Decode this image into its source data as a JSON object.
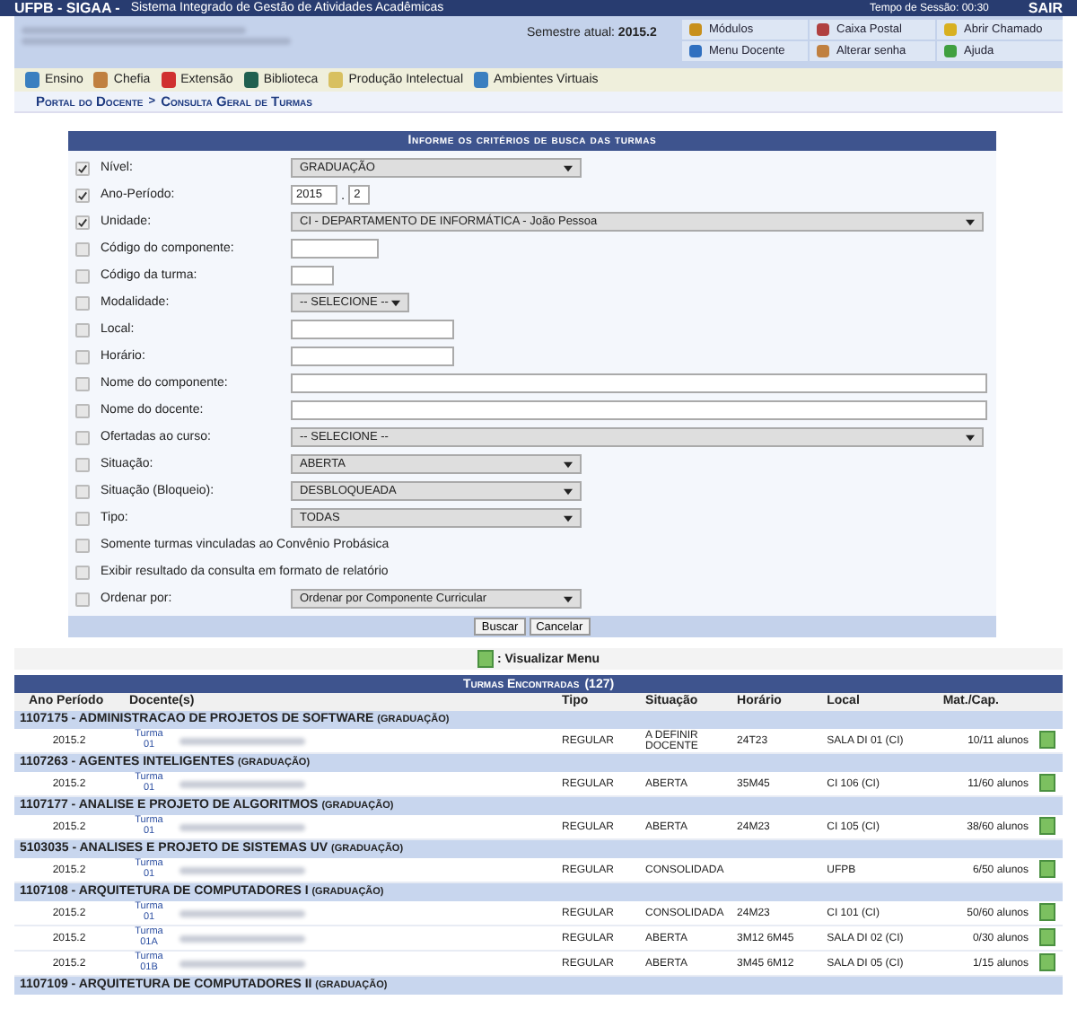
{
  "top_bar": {
    "title": "UFPB - SIGAA -",
    "subtitle": "Sistema Integrado de Gestão de Atividades Acadêmicas",
    "session": "Tempo de Sessão: 00:30",
    "logout": "SAIR"
  },
  "header": {
    "semester_label": "Semestre atual:",
    "semester": "2015.2",
    "shortcuts": [
      {
        "label": "Módulos"
      },
      {
        "label": "Caixa Postal"
      },
      {
        "label": "Abrir Chamado"
      },
      {
        "label": "Menu Docente"
      },
      {
        "label": "Alterar senha"
      },
      {
        "label": "Ajuda"
      }
    ]
  },
  "menu": [
    {
      "label": "Ensino"
    },
    {
      "label": "Chefia"
    },
    {
      "label": "Extensão"
    },
    {
      "label": "Biblioteca"
    },
    {
      "label": "Produção Intelectual"
    },
    {
      "label": "Ambientes Virtuais"
    }
  ],
  "breadcrumb": {
    "portal": "Portal do Docente",
    "separator": ">",
    "page": "Consulta Geral de Turmas"
  },
  "form": {
    "title": "Informe os critérios de busca das turmas",
    "fields": [
      {
        "label": "Nível:",
        "checked": true,
        "kind": "select",
        "value": "GRADUAÇÃO"
      },
      {
        "label": "Ano-Período:",
        "checked": true,
        "kind": "period",
        "value": "2015",
        "value_2": "2",
        "separator": "."
      },
      {
        "label": "Unidade:",
        "checked": true,
        "kind": "select_wide",
        "value": "CI - DEPARTAMENTO DE INFORMÁTICA - João Pessoa"
      },
      {
        "label": "Código do componente:",
        "checked": false,
        "kind": "text_short"
      },
      {
        "label": "Código da turma:",
        "checked": false,
        "kind": "text_tiny"
      },
      {
        "label": "Modalidade:",
        "checked": false,
        "kind": "select_short",
        "value": "-- SELECIONE --"
      },
      {
        "label": "Local:",
        "checked": false,
        "kind": "text_medium"
      },
      {
        "label": "Horário:",
        "checked": false,
        "kind": "text_medium"
      },
      {
        "label": "Nome do componente:",
        "checked": false,
        "kind": "text_long"
      },
      {
        "label": "Nome do docente:",
        "checked": false,
        "kind": "text_long"
      },
      {
        "label": "Ofertadas ao curso:",
        "checked": false,
        "kind": "select_wide",
        "value": "-- SELECIONE --"
      },
      {
        "label": "Situação:",
        "checked": false,
        "kind": "select",
        "value": "ABERTA"
      },
      {
        "label": "Situação (Bloqueio):",
        "checked": false,
        "kind": "select",
        "value": "DESBLOQUEADA"
      },
      {
        "label": "Tipo:",
        "checked": false,
        "kind": "select",
        "value": "TODAS"
      },
      {
        "label": "Somente turmas vinculadas ao Convênio Probásica",
        "checked": false,
        "kind": "none"
      },
      {
        "label": "Exibir resultado da consulta em formato de relatório",
        "checked": false,
        "kind": "none"
      },
      {
        "label": "Ordenar por:",
        "checked": false,
        "kind": "select",
        "value": "Ordenar por Componente Curricular"
      }
    ],
    "buttons": [
      "Buscar",
      "Cancelar"
    ]
  },
  "legend": {
    "text": ": Visualizar Menu"
  },
  "results": {
    "title": "Turmas Encontradas",
    "count": "(127)",
    "columns": [
      "Ano Período",
      "Docente(s)",
      "Tipo",
      "Situação",
      "Horário",
      "Local",
      "Mat./Cap."
    ],
    "groups": [
      {
        "title": "1107175 - ADMINISTRACAO DE PROJETOS DE SOFTWARE",
        "level": "(GRADUAÇÃO)",
        "classes": [
          {
            "period": "2015.2",
            "class": "Turma 01",
            "type": "REGULAR",
            "status": "A DEFINIR DOCENTE",
            "schedule": "24T23",
            "place": "SALA DI 01 (CI)",
            "enrolled": "10/11 alunos"
          }
        ]
      },
      {
        "title": "1107263 - AGENTES INTELIGENTES",
        "level": "(GRADUAÇÃO)",
        "classes": [
          {
            "period": "2015.2",
            "class": "Turma 01",
            "type": "REGULAR",
            "status": "ABERTA",
            "schedule": "35M45",
            "place": "CI 106 (CI)",
            "enrolled": "11/60 alunos"
          }
        ]
      },
      {
        "title": "1107177 - ANALISE E PROJETO DE ALGORITMOS",
        "level": "(GRADUAÇÃO)",
        "classes": [
          {
            "period": "2015.2",
            "class": "Turma 01",
            "type": "REGULAR",
            "status": "ABERTA",
            "schedule": "24M23",
            "place": "CI 105 (CI)",
            "enrolled": "38/60 alunos"
          }
        ]
      },
      {
        "title": "5103035 - ANALISES E PROJETO DE SISTEMAS UV",
        "level": "(GRADUAÇÃO)",
        "classes": [
          {
            "period": "2015.2",
            "class": "Turma 01",
            "type": "REGULAR",
            "status": "CONSOLIDADA",
            "place": "UFPB",
            "enrolled": "6/50 alunos"
          }
        ]
      },
      {
        "title": "1107108 - ARQUITETURA DE COMPUTADORES I",
        "level": "(GRADUAÇÃO)",
        "classes": [
          {
            "period": "2015.2",
            "class": "Turma 01",
            "type": "REGULAR",
            "status": "CONSOLIDADA",
            "schedule": "24M23",
            "place": "CI 101 (CI)",
            "enrolled": "50/60 alunos"
          },
          {
            "period": "2015.2",
            "class": "Turma 01A",
            "type": "REGULAR",
            "status": "ABERTA",
            "schedule": "3M12 6M45",
            "place": "SALA DI 02 (CI)",
            "enrolled": "0/30 alunos"
          },
          {
            "period": "2015.2",
            "class": "Turma 01B",
            "type": "REGULAR",
            "status": "ABERTA",
            "schedule": "3M45 6M12",
            "place": "SALA DI 05 (CI)",
            "enrolled": "1/15 alunos"
          }
        ]
      },
      {
        "title": "1107109 - ARQUITETURA DE COMPUTADORES II",
        "level": "(GRADUAÇÃO)"
      }
    ]
  }
}
